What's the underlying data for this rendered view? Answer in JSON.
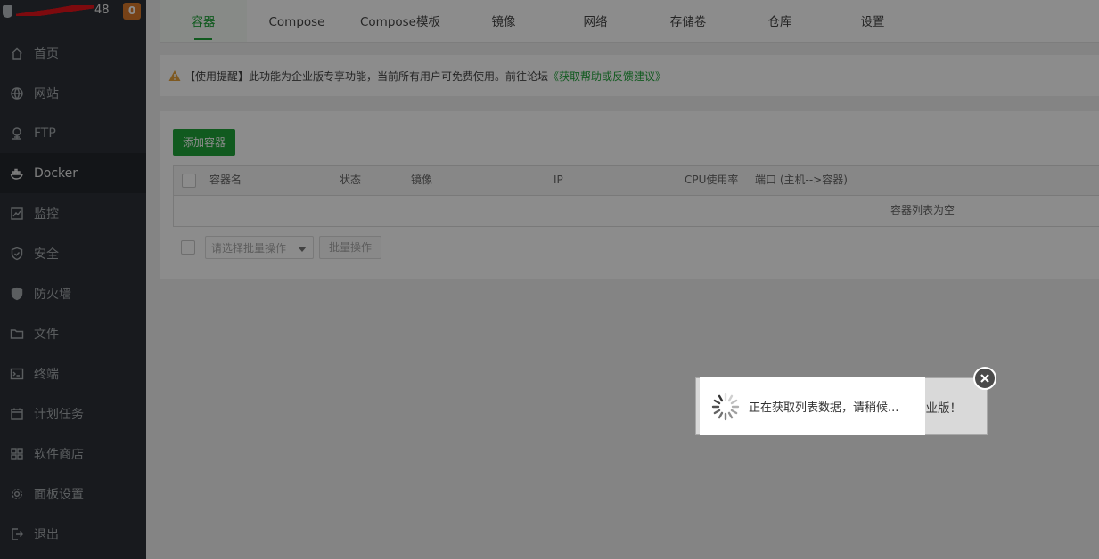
{
  "sidebar": {
    "server_name_suffix": "48",
    "badge": "0",
    "items": [
      {
        "label": "首页",
        "icon": "home-icon"
      },
      {
        "label": "网站",
        "icon": "globe-icon"
      },
      {
        "label": "FTP",
        "icon": "ftp-icon"
      },
      {
        "label": "Docker",
        "icon": "docker-icon",
        "active": true
      },
      {
        "label": "监控",
        "icon": "monitor-icon"
      },
      {
        "label": "安全",
        "icon": "shield-check-icon"
      },
      {
        "label": "防火墙",
        "icon": "firewall-shield-icon"
      },
      {
        "label": "文件",
        "icon": "folder-icon"
      },
      {
        "label": "终端",
        "icon": "terminal-icon"
      },
      {
        "label": "计划任务",
        "icon": "calendar-icon"
      },
      {
        "label": "软件商店",
        "icon": "grid-icon"
      },
      {
        "label": "面板设置",
        "icon": "gear-icon"
      },
      {
        "label": "退出",
        "icon": "logout-icon"
      }
    ]
  },
  "tabs": [
    {
      "label": "容器",
      "active": true
    },
    {
      "label": "Compose"
    },
    {
      "label": "Compose模板"
    },
    {
      "label": "镜像"
    },
    {
      "label": "网络"
    },
    {
      "label": "存储卷"
    },
    {
      "label": "仓库"
    },
    {
      "label": "设置"
    }
  ],
  "notice": {
    "text": "【使用提醒】此功能为企业版专享功能，当前所有用户可免费使用。前往论坛",
    "link": "《获取帮助或反馈建议》"
  },
  "toolbar": {
    "add_label": "添加容器"
  },
  "table": {
    "columns": [
      "容器名",
      "状态",
      "镜像",
      "IP",
      "CPU使用率",
      "端口 (主机-->容器)"
    ],
    "empty_text": "容器列表为空"
  },
  "batch": {
    "select_placeholder": "请选择批量操作",
    "button_label": "批量操作"
  },
  "overlay": {
    "behind_text": "企业版！",
    "loading_text": "正在获取列表数据，请稍候..."
  },
  "colors": {
    "accent": "#20a53a",
    "sidebar_bg": "#2c3138",
    "badge": "#d9792b",
    "warning": "#e6a23c"
  }
}
